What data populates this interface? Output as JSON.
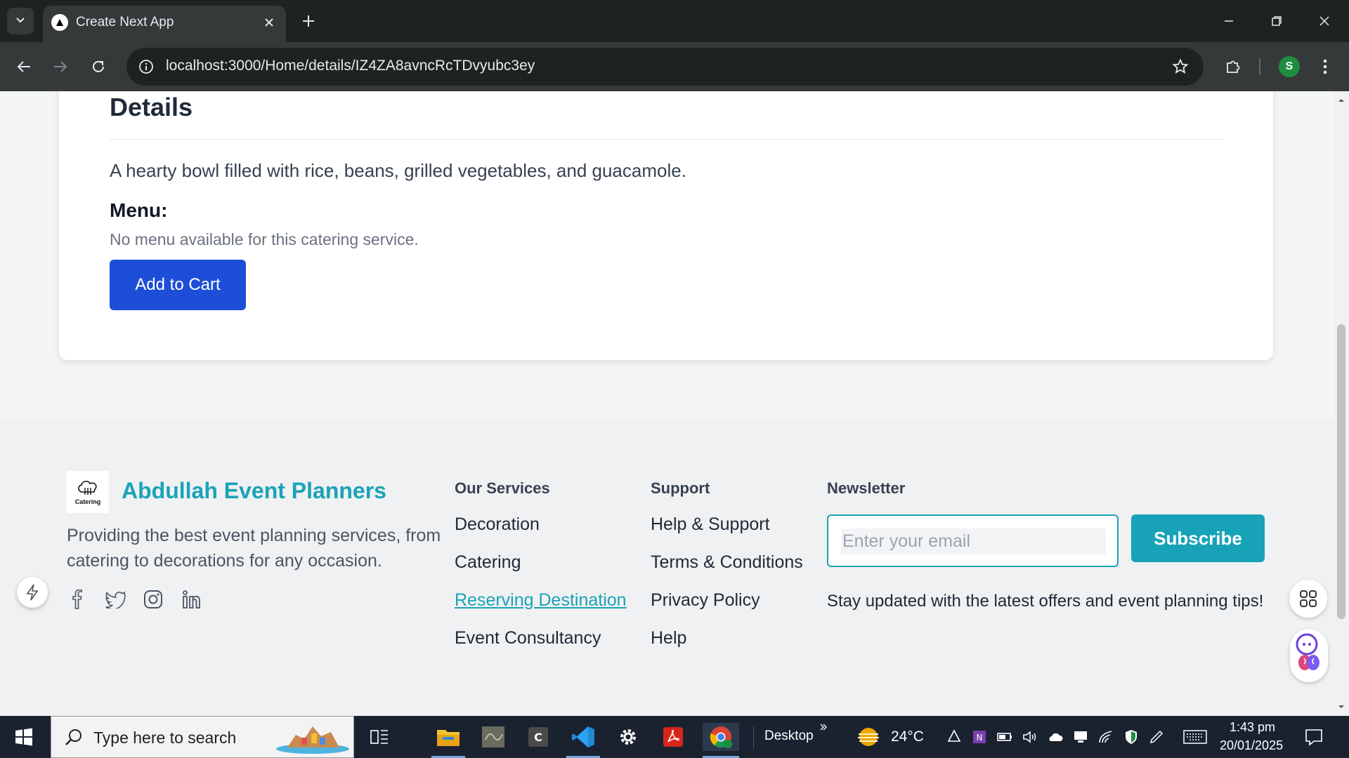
{
  "browser": {
    "tab_title": "Create Next App",
    "url": "localhost:3000/Home/details/IZ4ZA8avncRcTDvyubc3ey",
    "profile_initial": "S"
  },
  "details": {
    "title": "Details",
    "description": "A hearty bowl filled with rice, beans, grilled vegetables, and guacamole.",
    "menu_title": "Menu:",
    "menu_empty": "No menu available for this catering service.",
    "add_to_cart": "Add to Cart"
  },
  "footer": {
    "logo_text": "Catering",
    "brand": "Abdullah Event Planners",
    "about": "Providing the best event planning services, from catering to decorations for any occasion.",
    "socials": [
      "facebook-icon",
      "twitter-icon",
      "instagram-icon",
      "linkedin-icon"
    ],
    "services": {
      "heading": "Our Services",
      "links": [
        "Decoration",
        "Catering",
        "Reserving Destination",
        "Event Consultancy"
      ],
      "active_link": "Reserving Destination"
    },
    "support": {
      "heading": "Support",
      "links": [
        "Help & Support",
        "Terms & Conditions",
        "Privacy Policy",
        "Help"
      ]
    },
    "newsletter": {
      "heading": "Newsletter",
      "email_placeholder": "Enter your email",
      "email_value": "",
      "subscribe": "Subscribe",
      "note": "Stay updated with the latest offers and event planning tips!"
    }
  },
  "taskbar": {
    "search_placeholder": "Type here to search",
    "desktop_label": "Desktop",
    "temperature": "24°C",
    "time": "1:43 pm",
    "date": "20/01/2025"
  },
  "colors": {
    "accent_teal": "#1aa3b8",
    "cart_blue": "#1d4ed8",
    "subscribe_teal": "#17a2b8"
  }
}
